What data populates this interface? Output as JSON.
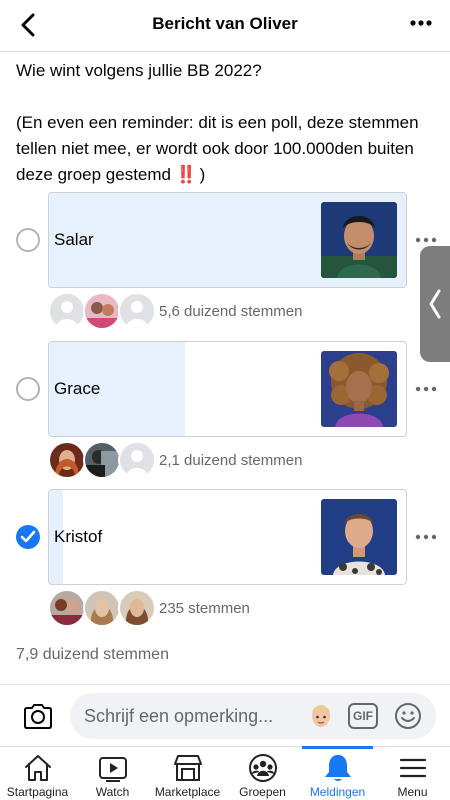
{
  "header": {
    "title": "Bericht van Oliver"
  },
  "post": {
    "line1": "Wie wint volgens jullie BB 2022?",
    "line2": "(En even een reminder: dit is een poll, deze stemmen tellen niet mee, er wordt ook door 100.000den buiten deze groep gestemd",
    "emoji": "‼️",
    "line2_end": ")"
  },
  "poll": {
    "options": [
      {
        "label": "Salar",
        "share": 1.0,
        "selected": false,
        "votes": "5,6 duizend stemmen"
      },
      {
        "label": "Grace",
        "share": 0.38,
        "selected": false,
        "votes": "2,1 duizend stemmen"
      },
      {
        "label": "Kristof",
        "share": 0.04,
        "selected": true,
        "votes": "235 stemmen"
      }
    ],
    "total": "7,9 duizend stemmen"
  },
  "comment": {
    "placeholder": "Schrijf een opmerking...",
    "gif": "GIF"
  },
  "tabs": [
    {
      "label": "Startpagina",
      "icon": "home-icon"
    },
    {
      "label": "Watch",
      "icon": "watch-icon"
    },
    {
      "label": "Marketplace",
      "icon": "marketplace-icon"
    },
    {
      "label": "Groepen",
      "icon": "groups-icon"
    },
    {
      "label": "Meldingen",
      "icon": "bell-icon",
      "active": true
    },
    {
      "label": "Menu",
      "icon": "menu-icon"
    }
  ],
  "colors": {
    "accent": "#1877f2",
    "fill": "#e7f0fd",
    "muted": "#65676b"
  }
}
